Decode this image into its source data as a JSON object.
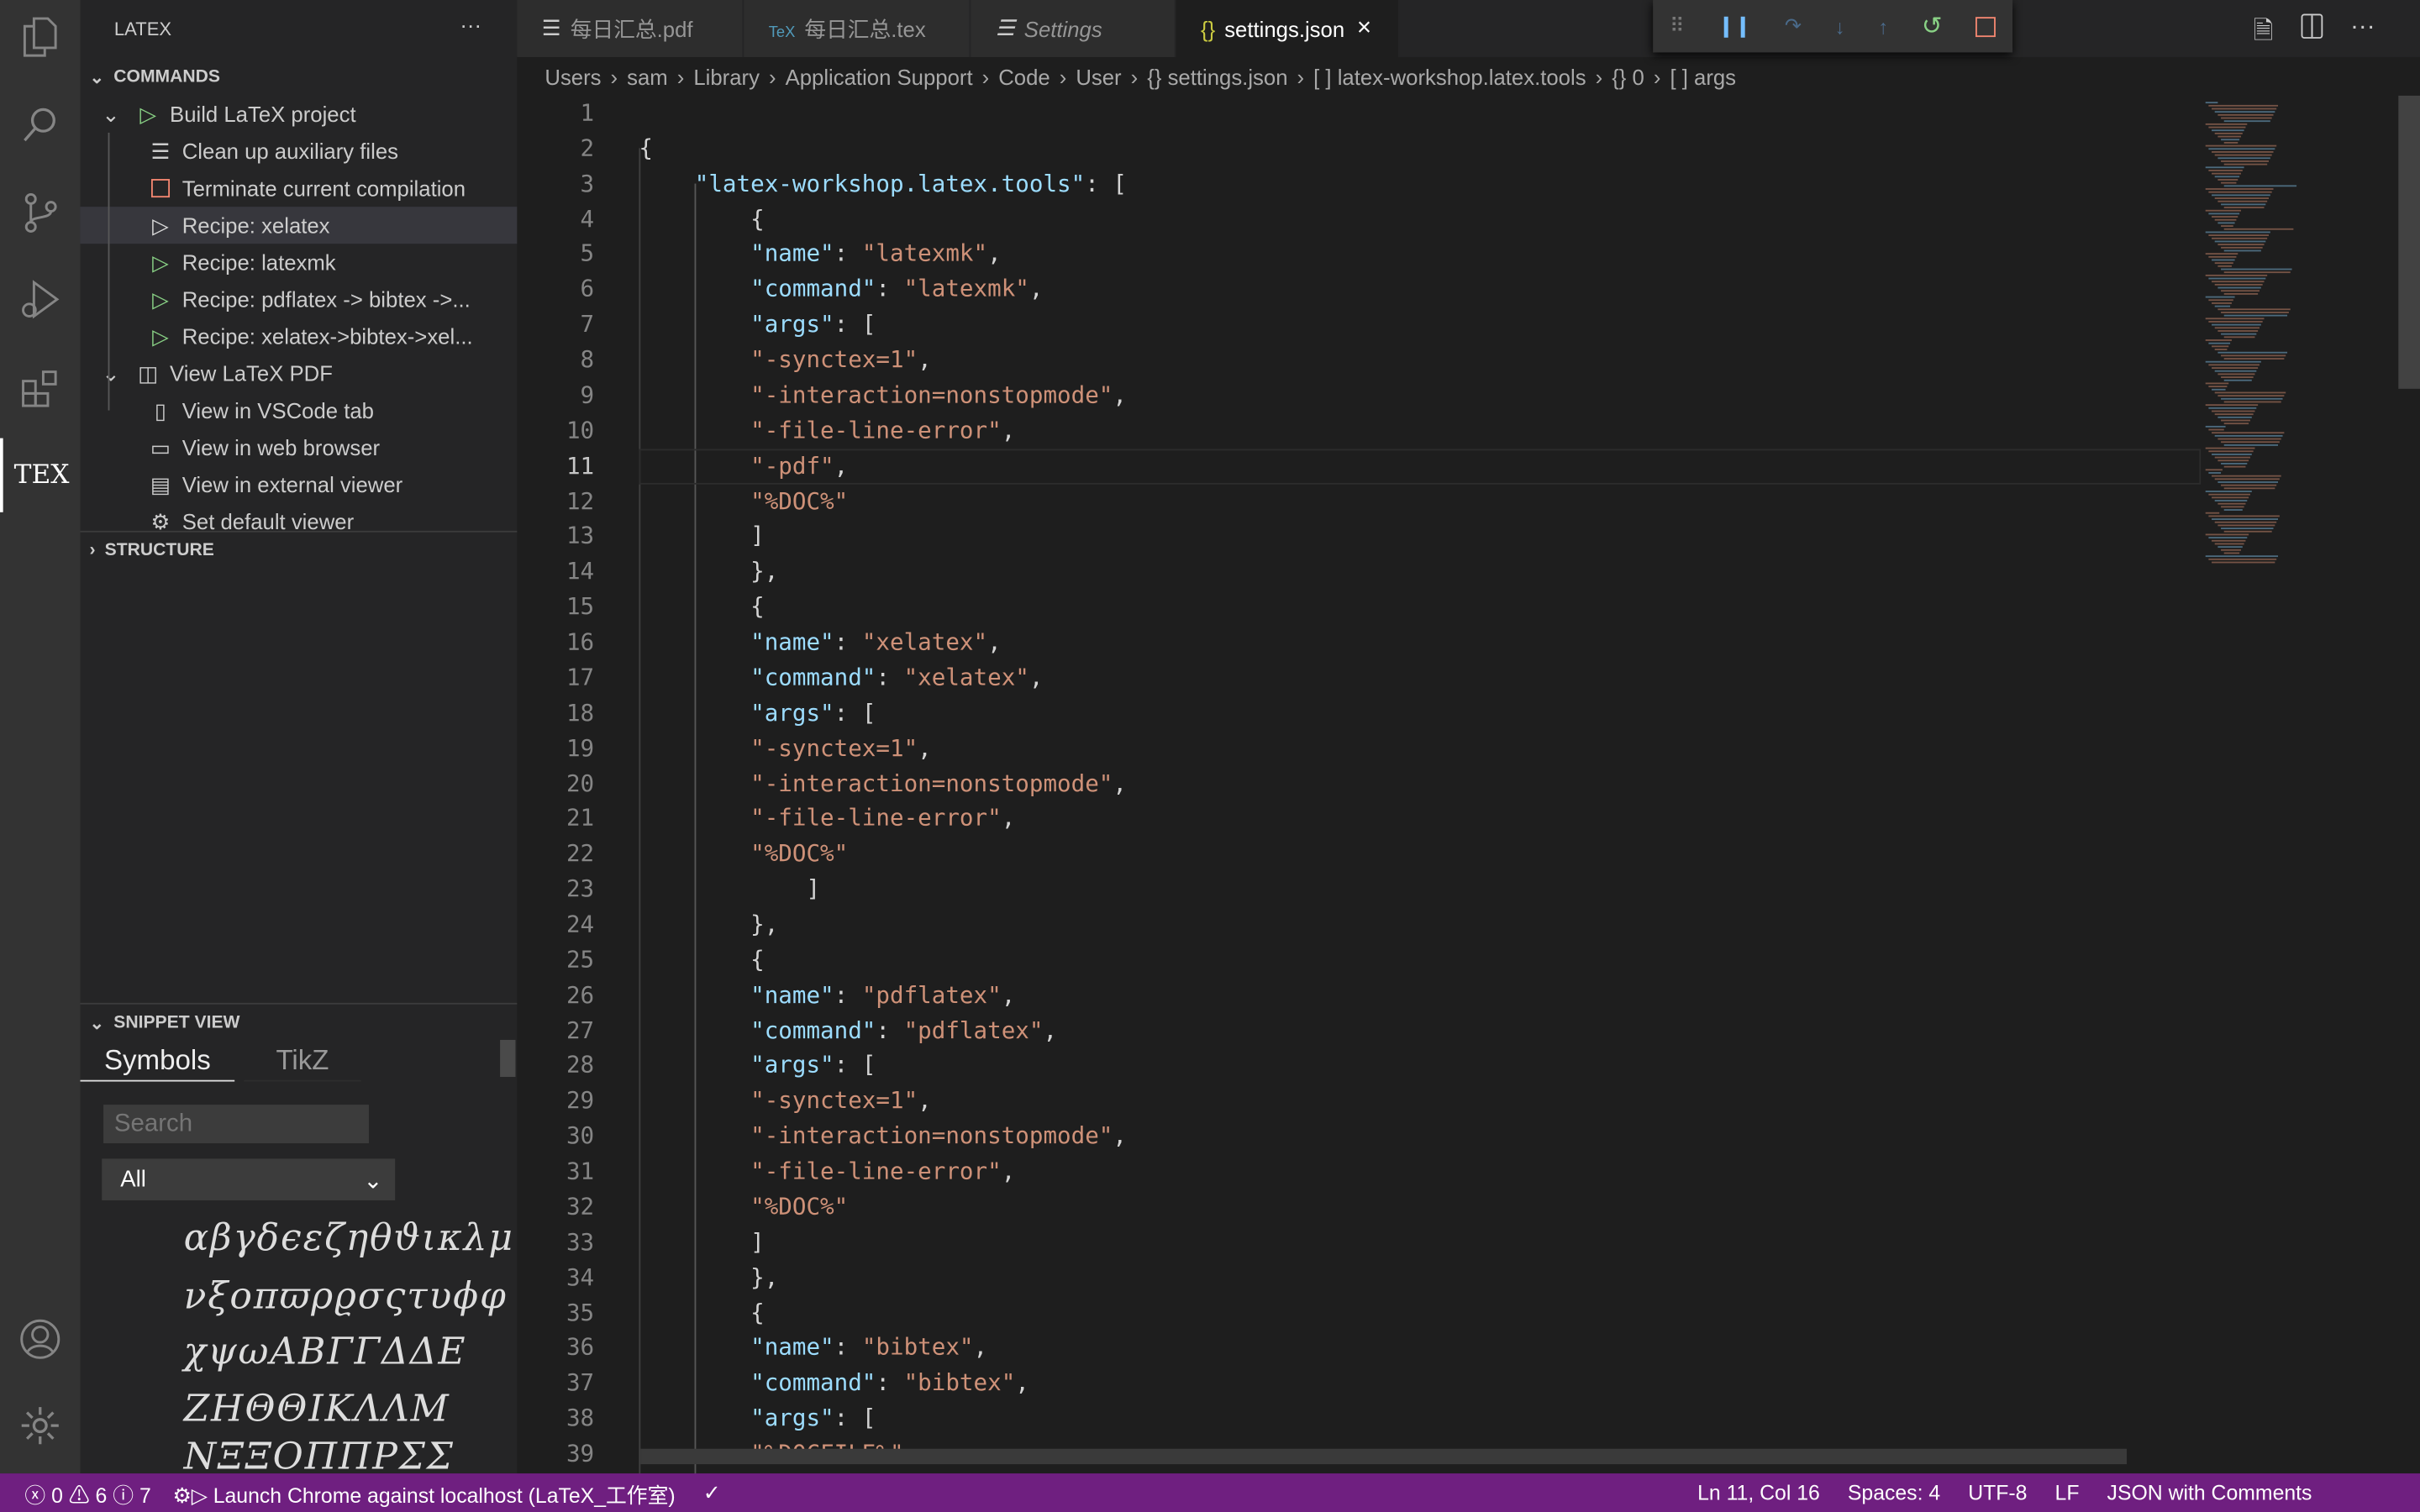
{
  "activity_bar": {
    "items": [
      "explorer-icon",
      "search-icon",
      "source-control-icon",
      "run-debug-icon",
      "extensions-icon",
      "tex-icon"
    ],
    "tex_label": "TEX",
    "bottom": [
      "account-icon",
      "manage-gear-icon"
    ]
  },
  "sidebar": {
    "title": "LATEX",
    "more": "···",
    "commands_header": "COMMANDS",
    "commands": [
      {
        "label": "Build LaTeX project",
        "icon": "play-icon",
        "level": 0,
        "twisty": true
      },
      {
        "label": "Clean up auxiliary files",
        "icon": "clear-icon",
        "level": 1
      },
      {
        "label": "Terminate current compilation",
        "icon": "stop-icon",
        "level": 1
      },
      {
        "label": "Recipe: xelatex",
        "icon": "play-outline-icon",
        "level": 1,
        "selected": true
      },
      {
        "label": "Recipe: latexmk",
        "icon": "play-icon",
        "level": 1
      },
      {
        "label": "Recipe: pdflatex -> bibtex ->...",
        "icon": "play-icon",
        "level": 1
      },
      {
        "label": "Recipe: xelatex->bibtex->xel...",
        "icon": "play-icon",
        "level": 1
      },
      {
        "label": "View LaTeX PDF",
        "icon": "preview-icon",
        "level": 0,
        "twisty": true
      },
      {
        "label": "View in VSCode tab",
        "icon": "book-icon",
        "level": 1
      },
      {
        "label": "View in web browser",
        "icon": "browser-icon",
        "level": 1
      },
      {
        "label": "View in external viewer",
        "icon": "external-icon",
        "level": 1
      },
      {
        "label": "Set default viewer",
        "icon": "gear-icon",
        "level": 1
      }
    ],
    "structure_header": "STRUCTURE",
    "snippet_header": "SNIPPET VIEW",
    "snippet_tabs": [
      "Symbols",
      "TikZ"
    ],
    "search_placeholder": "Search",
    "filter_value": "All",
    "symbol_rows": [
      "αβγδϵεζηθϑικλμ",
      "νξοπϖρϱσςτυϕφ",
      "χψωΑΒΓΓΔΔΕ",
      "ΖΗΘΘΙΚΛΛΜ",
      "ΝΞΞΟΠΠΡΣΣ"
    ]
  },
  "tabs": [
    {
      "label": "每日汇总.pdf",
      "icon": "preview-icon"
    },
    {
      "label": "每日汇总.tex",
      "icon": "tex-file-icon"
    },
    {
      "label": "Settings",
      "icon": "settings-list-icon",
      "italic": true
    },
    {
      "label": "settings.json",
      "icon": "json-braces-icon",
      "active": true,
      "close": "×"
    }
  ],
  "breadcrumb": [
    "Users",
    "sam",
    "Library",
    "Application Support",
    "Code",
    "User",
    "{} settings.json",
    "[ ] latex-workshop.latex.tools",
    "{} 0",
    "[ ] args"
  ],
  "editor": {
    "current_line": 11,
    "lines": [
      "",
      "{",
      "    \"latex-workshop.latex.tools\": [",
      "        {",
      "        \"name\": \"latexmk\",",
      "        \"command\": \"latexmk\",",
      "        \"args\": [",
      "        \"-synctex=1\",",
      "        \"-interaction=nonstopmode\",",
      "        \"-file-line-error\",",
      "        \"-pdf\",",
      "        \"%DOC%\"",
      "        ]",
      "        },",
      "        {",
      "        \"name\": \"xelatex\",",
      "        \"command\": \"xelatex\",",
      "        \"args\": [",
      "        \"-synctex=1\",",
      "        \"-interaction=nonstopmode\",",
      "        \"-file-line-error\",",
      "        \"%DOC%\"",
      "            ]",
      "        },",
      "        {",
      "        \"name\": \"pdflatex\",",
      "        \"command\": \"pdflatex\",",
      "        \"args\": [",
      "        \"-synctex=1\",",
      "        \"-interaction=nonstopmode\",",
      "        \"-file-line-error\",",
      "        \"%DOC%\"",
      "        ]",
      "        },",
      "        {",
      "        \"name\": \"bibtex\",",
      "        \"command\": \"bibtex\",",
      "        \"args\": [",
      "        \"%DOCFILE%\""
    ]
  },
  "debug_toolbar": [
    "drag-handle-icon",
    "pause-icon",
    "step-over-icon",
    "step-into-icon",
    "step-out-icon",
    "restart-icon",
    "stop-icon"
  ],
  "editor_actions": [
    "open-preview-icon",
    "split-editor-icon",
    "more-actions-icon"
  ],
  "status": {
    "errors": "0",
    "warnings": "6",
    "infos": "7",
    "launch": "Launch Chrome against localhost (LaTeX_工作室)",
    "check": "✓",
    "position": "Ln 11, Col 16",
    "spaces": "Spaces: 4",
    "encoding": "UTF-8",
    "eol": "LF",
    "language": "JSON with Comments"
  },
  "colors": {
    "status_bar": "#6f1f80",
    "key": "#9cdcfe",
    "string": "#ce9178",
    "accent_green": "#89d185",
    "stop_red": "#f48771"
  }
}
